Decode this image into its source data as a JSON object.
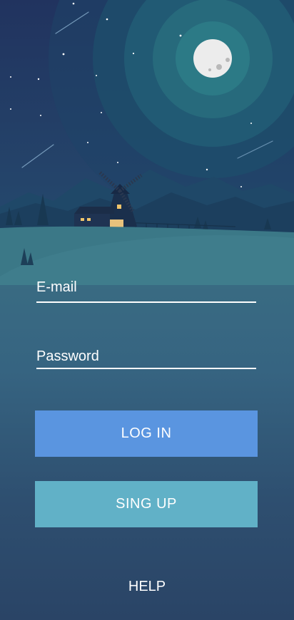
{
  "login_form": {
    "email_placeholder": "E-mail",
    "email_value": "",
    "password_placeholder": "Password",
    "password_value": "",
    "login_button": "LOG IN",
    "signup_button": "SING UP",
    "help_link": "HELP"
  },
  "colors": {
    "sky": "#223a66",
    "moon": "#ececec",
    "hill": "#3f7d8c",
    "login_button": "#5a95e0",
    "signup_button": "#61b1c7",
    "text": "#ffffff"
  },
  "icons": [
    "moon-icon",
    "windmill-icon",
    "house-icon"
  ]
}
